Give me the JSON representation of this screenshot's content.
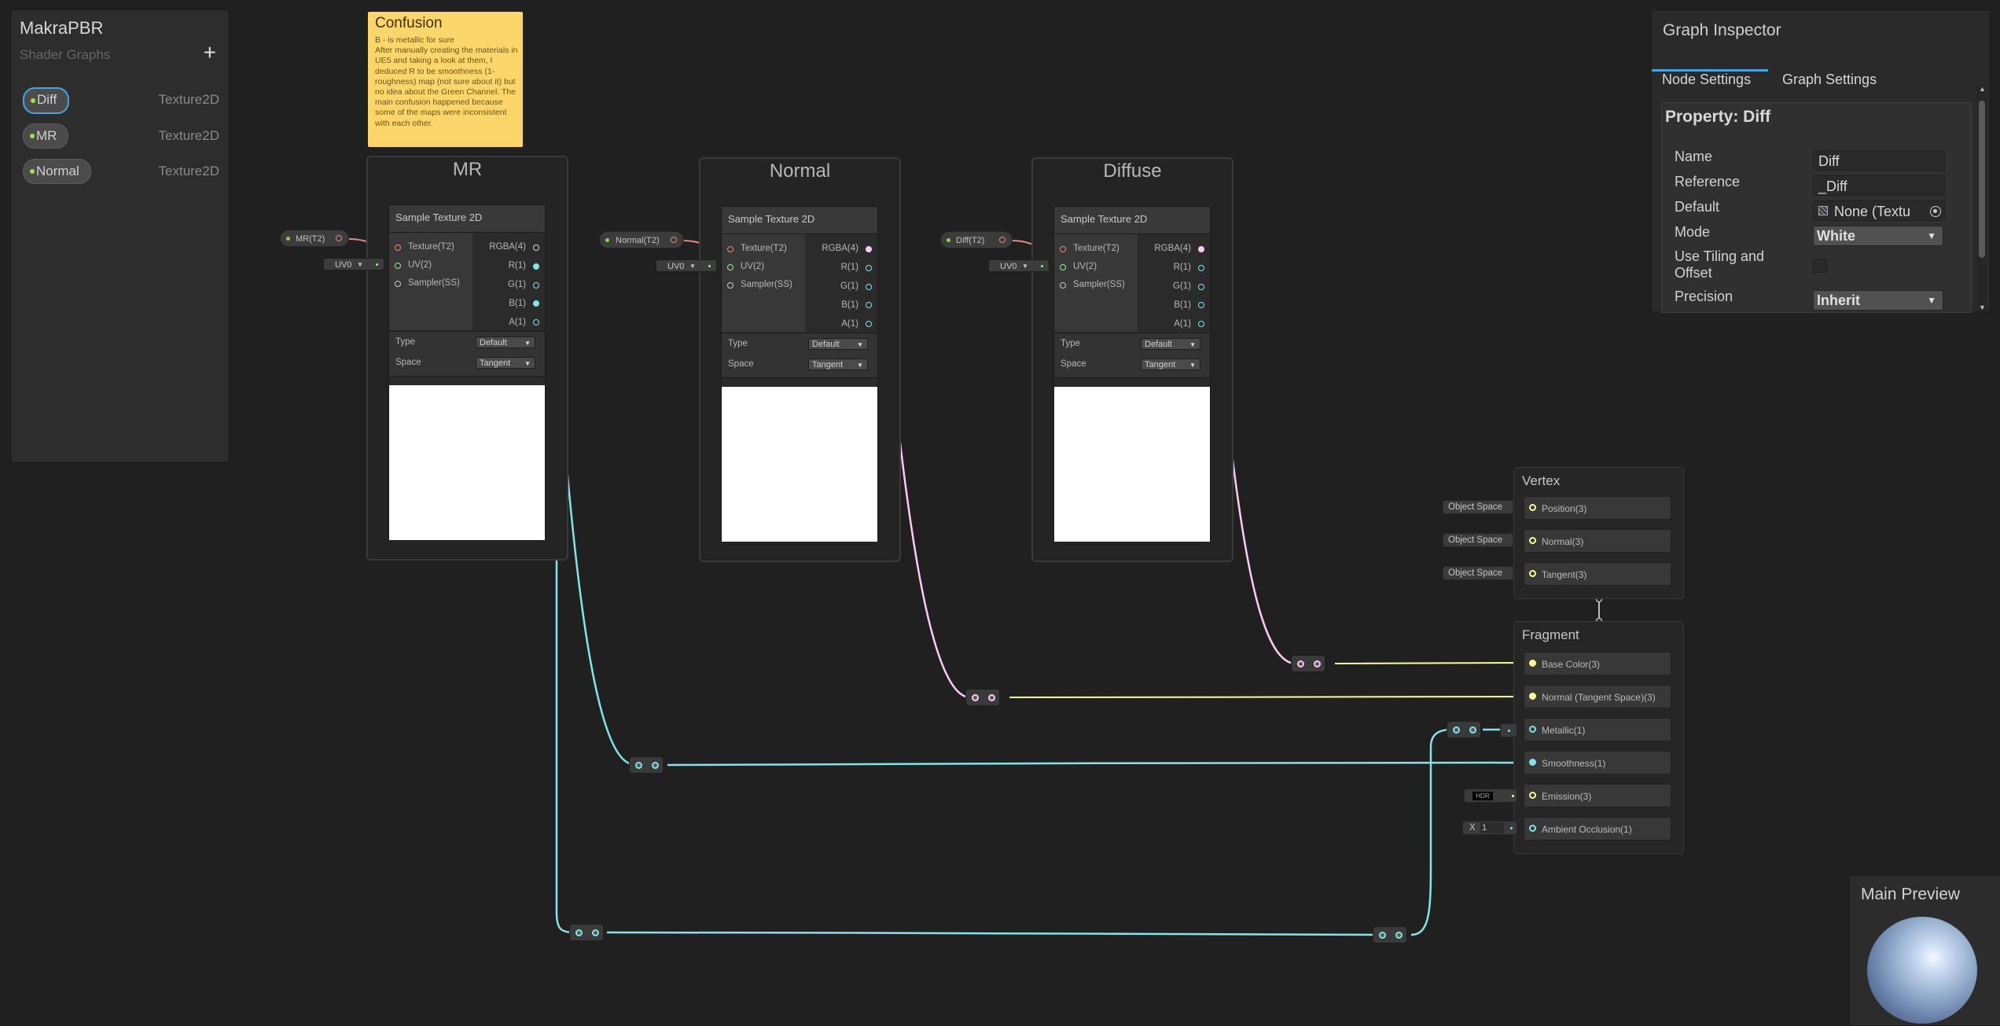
{
  "blackboard": {
    "title": "MakraPBR",
    "subtitle": "Shader Graphs",
    "add": "+",
    "properties": [
      {
        "name": "Diff",
        "type": "Texture2D",
        "selected": true
      },
      {
        "name": "MR",
        "type": "Texture2D",
        "selected": false
      },
      {
        "name": "Normal",
        "type": "Texture2D",
        "selected": false
      }
    ]
  },
  "sticky": {
    "title": "Confusion",
    "body": "B - is metallic for sure\nAfter manually creating the materials in UE5 and taking a look at them, I deduced R to be smoothness (1-roughness) map (not sure about it) but no idea about the Green Channel. The main confusion happened because some of the maps were inconsistent with each other."
  },
  "groups": [
    {
      "title": "MR",
      "chip": "MR(T2)"
    },
    {
      "title": "Normal",
      "chip": "Normal(T2)"
    },
    {
      "title": "Diffuse",
      "chip": "Diff(T2)"
    }
  ],
  "sample_node": {
    "title": "Sample Texture 2D",
    "inputs": [
      "Texture(T2)",
      "UV(2)",
      "Sampler(SS)"
    ],
    "outputs": [
      "RGBA(4)",
      "R(1)",
      "G(1)",
      "B(1)",
      "A(1)"
    ],
    "type_label": "Type",
    "type_value": "Default",
    "space_label": "Space",
    "space_value": "Tangent",
    "uv_value": "UV0"
  },
  "vertex": {
    "title": "Vertex",
    "blocks": [
      "Position(3)",
      "Normal(3)",
      "Tangent(3)"
    ],
    "space": "Object Space"
  },
  "fragment": {
    "title": "Fragment",
    "blocks": [
      "Base Color(3)",
      "Normal (Tangent Space)(3)",
      "Metallic(1)",
      "Smoothness(1)",
      "Emission(3)",
      "Ambient Occlusion(1)"
    ],
    "hdr": "HDR",
    "ao_axis": "X",
    "ao_value": "1"
  },
  "inspector": {
    "title": "Graph Inspector",
    "tabs": [
      "Node Settings",
      "Graph Settings"
    ],
    "active_tab": "Node Settings",
    "section": "Property: Diff",
    "fields": {
      "name_label": "Name",
      "name_value": "Diff",
      "ref_label": "Reference",
      "ref_value": "_Diff",
      "default_label": "Default",
      "default_value": "None (Textu",
      "mode_label": "Mode",
      "mode_value": "White",
      "tiling_label": "Use Tiling and Offset",
      "precision_label": "Precision",
      "precision_value": "Inherit"
    }
  },
  "main_preview": {
    "title": "Main Preview"
  },
  "colors": {
    "texture_port": "#e98686",
    "vector1_port": "#84e4e7",
    "vector4_port": "#fbcbf4",
    "vector3_port": "#f6ff9a",
    "vector2_port": "#9aef92",
    "accent": "#4aa1e0"
  }
}
